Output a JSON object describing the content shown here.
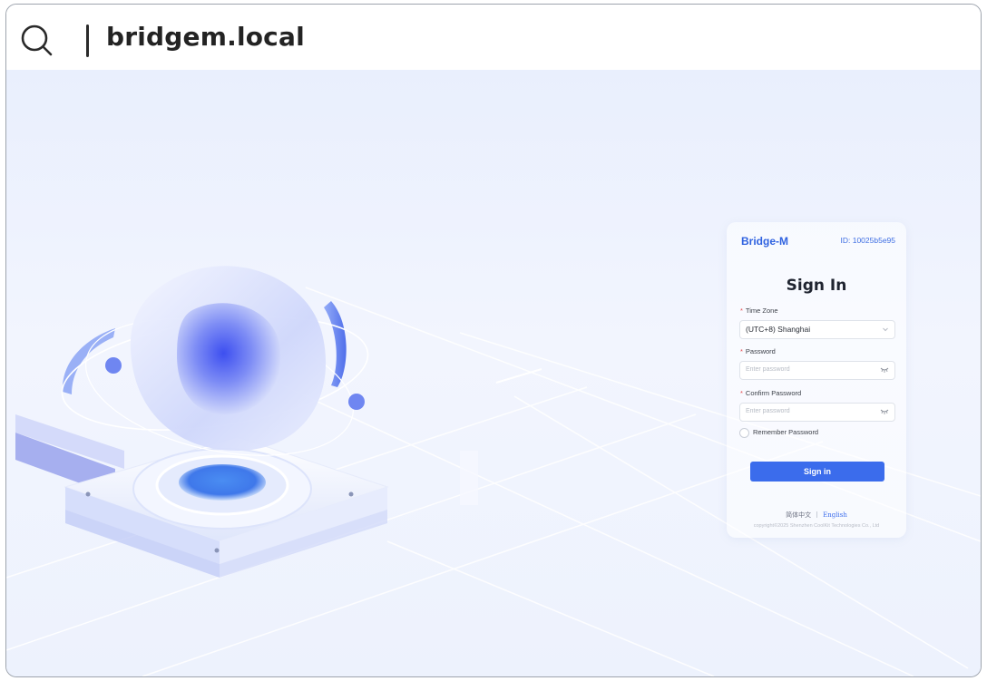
{
  "browser": {
    "url": "bridgem.local",
    "search_icon": "search-icon"
  },
  "login": {
    "brand": "Bridge-M",
    "device_id": "ID: 10025b5e95",
    "title": "Sign In",
    "timezone": {
      "label": "Time Zone",
      "value": "(UTC+8) Shanghai"
    },
    "password": {
      "label": "Password",
      "placeholder": "Enter password"
    },
    "confirm_password": {
      "label": "Confirm Password",
      "placeholder": "Enter password"
    },
    "remember_label": "Remember Password",
    "submit_label": "Sign in",
    "lang_zh": "简体中文",
    "lang_en": "English",
    "copyright": "copyright©2025 Shenzhen CoolKit Technologies Co., Ltd"
  },
  "colors": {
    "accent": "#3b6cec",
    "brand": "#2f62e0",
    "required": "#e5484d"
  }
}
